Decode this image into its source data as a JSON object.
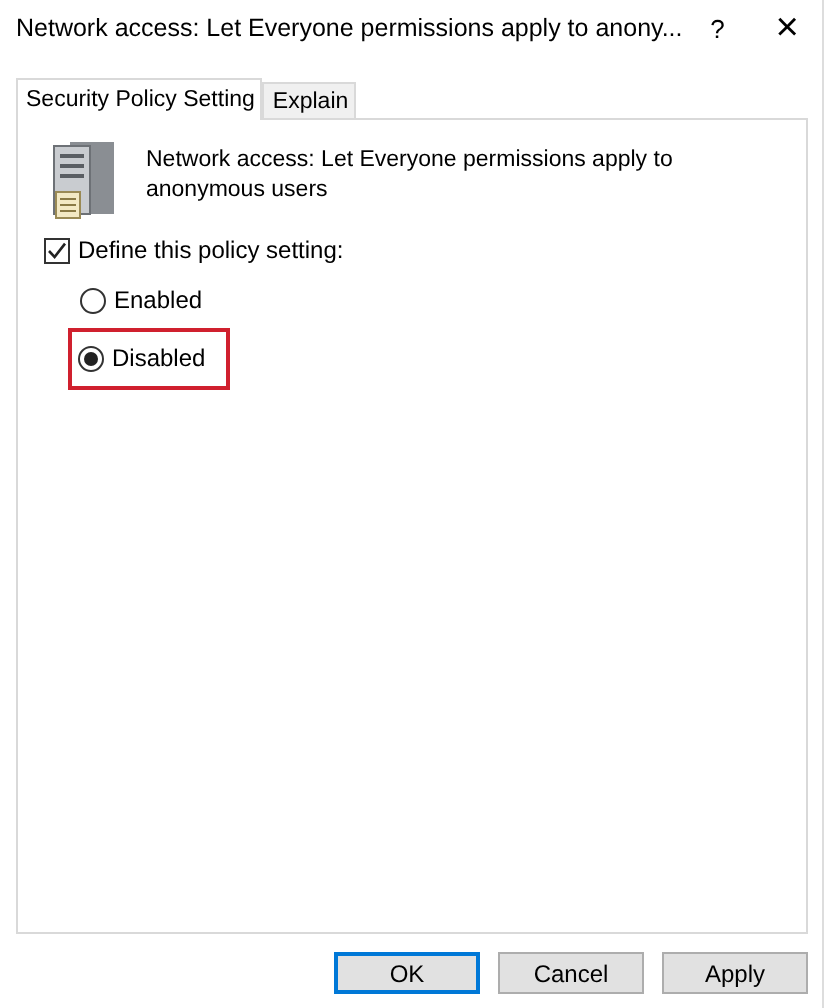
{
  "window": {
    "title": "Network access: Let Everyone permissions apply to anony...",
    "help": "?",
    "close": "×"
  },
  "tabs": [
    {
      "label": "Security Policy Setting",
      "selected": true
    },
    {
      "label": "Explain",
      "selected": false
    }
  ],
  "policy": {
    "name": "Network access: Let Everyone permissions apply to anonymous users"
  },
  "define": {
    "label": "Define this policy setting:",
    "checked": true
  },
  "options": [
    {
      "label": "Enabled",
      "selected": false,
      "highlighted": false
    },
    {
      "label": "Disabled",
      "selected": true,
      "highlighted": true
    }
  ],
  "buttons": [
    {
      "label": "OK",
      "default": true
    },
    {
      "label": "Cancel",
      "default": false
    },
    {
      "label": "Apply",
      "default": false
    }
  ]
}
